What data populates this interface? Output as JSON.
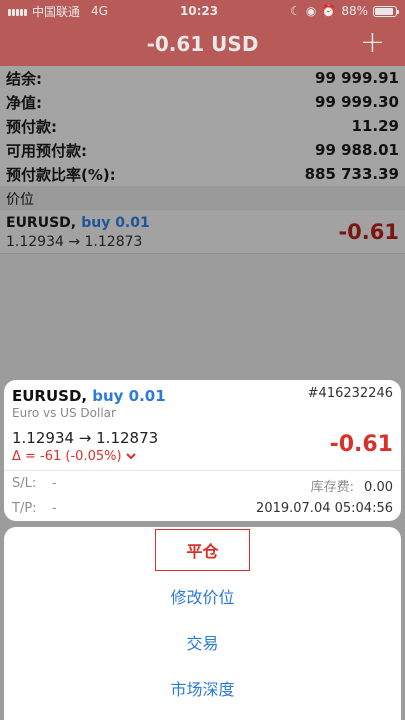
{
  "status_bar": {
    "carrier": "中国联通",
    "network": "4G",
    "time": "10:23",
    "battery": "88%",
    "battery_level": 0.88
  },
  "header": {
    "title": "-0.61 USD",
    "add_symbol": "+"
  },
  "account": [
    {
      "label": "结余:",
      "value": "99 999.91"
    },
    {
      "label": "净值:",
      "value": "99 999.30"
    },
    {
      "label": "预付款:",
      "value": "11.29"
    },
    {
      "label": "可用预付款:",
      "value": "99 988.01"
    },
    {
      "label": "预付款比率(%):",
      "value": "885 733.39"
    }
  ],
  "positions_section": "价位",
  "position": {
    "symbol": "EURUSD,",
    "side": "buy 0.01",
    "prices": "1.12934 → 1.12873",
    "profit": "-0.61"
  },
  "detail": {
    "symbol": "EURUSD,",
    "side": "buy 0.01",
    "ticket": "#416232246",
    "description": "Euro vs US Dollar",
    "prices": "1.12934 → 1.12873",
    "delta": "Δ = -61 (-0.05%)",
    "profit": "-0.61",
    "sl_label": "S/L:",
    "sl_value": "-",
    "tp_label": "T/P:",
    "tp_value": "-",
    "swap_label": "库存费:",
    "swap_value": "0.00",
    "open_time": "2019.07.04 05:04:56"
  },
  "actions": {
    "close": "平仓",
    "modify": "修改价位",
    "trade": "交易",
    "depth": "市场深度"
  },
  "colors": {
    "header_red": "#b85b58",
    "profit_red": "#d8312a",
    "link_blue": "#2b7ad9"
  }
}
